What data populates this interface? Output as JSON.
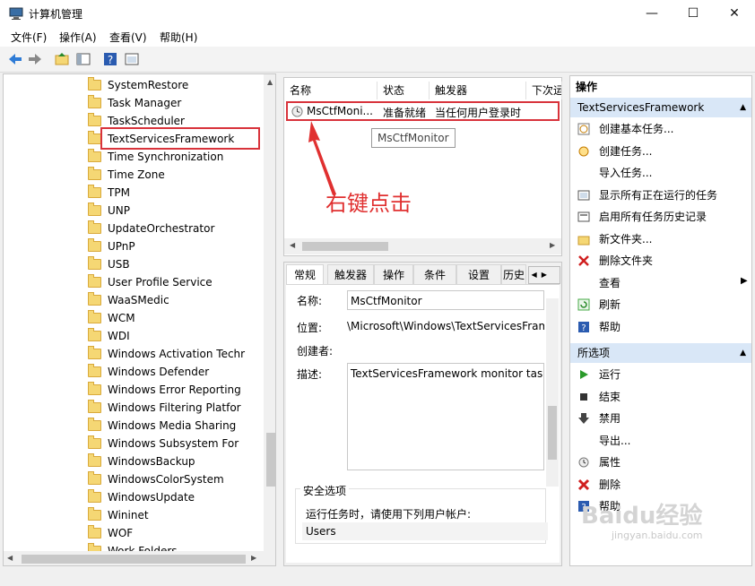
{
  "window": {
    "title": "计算机管理"
  },
  "menu": {
    "file": "文件(F)",
    "action": "操作(A)",
    "view": "查看(V)",
    "help": "帮助(H)"
  },
  "tree": [
    "SystemRestore",
    "Task Manager",
    "TaskScheduler",
    "TextServicesFramework",
    "Time Synchronization",
    "Time Zone",
    "TPM",
    "UNP",
    "UpdateOrchestrator",
    "UPnP",
    "USB",
    "User Profile Service",
    "WaaSMedic",
    "WCM",
    "WDI",
    "Windows Activation Techr",
    "Windows Defender",
    "Windows Error Reporting",
    "Windows Filtering Platfor",
    "Windows Media Sharing",
    "Windows Subsystem For",
    "WindowsBackup",
    "WindowsColorSystem",
    "WindowsUpdate",
    "Wininet",
    "WOF",
    "Work Folders"
  ],
  "tasklist": {
    "headers": [
      "名称",
      "状态",
      "触发器",
      "下次运"
    ],
    "row": {
      "name": "MsCtfMoni...",
      "status": "准备就绪",
      "trigger": "当任何用户登录时"
    },
    "tooltip": "MsCtfMonitor"
  },
  "annotation": {
    "text": "右键点击",
    "color": "#e03030"
  },
  "props": {
    "tabs": [
      "常规",
      "触发器",
      "操作",
      "条件",
      "设置",
      "历史"
    ],
    "name_label": "名称:",
    "name_value": "MsCtfMonitor",
    "location_label": "位置:",
    "location_value": "\\Microsoft\\Windows\\TextServicesFram",
    "author_label": "创建者:",
    "desc_label": "描述:",
    "desc_value": "TextServicesFramework monitor task",
    "security_title": "安全选项",
    "security_text": "运行任务时，请使用下列用户帐户:",
    "security_user": "Users"
  },
  "actions": {
    "header": "操作",
    "section1": "TextServicesFramework",
    "items1": [
      "创建基本任务...",
      "创建任务...",
      "导入任务...",
      "显示所有正在运行的任务",
      "启用所有任务历史记录",
      "新文件夹...",
      "删除文件夹",
      "查看",
      "刷新",
      "帮助"
    ],
    "section2": "所选项",
    "items2": [
      "运行",
      "结束",
      "禁用",
      "导出...",
      "属性",
      "删除",
      "帮助"
    ]
  },
  "watermark": {
    "brand": "Baidu经验",
    "url": "jingyan.baidu.com"
  }
}
